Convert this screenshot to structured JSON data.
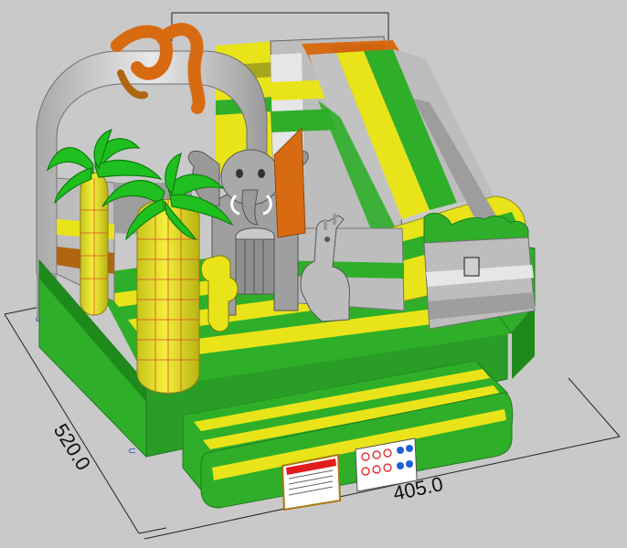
{
  "dimensions": {
    "depth_label": "520.0",
    "width_label": "405.0"
  },
  "colors": {
    "background": "#c9c9c9",
    "green": "#2fae2a",
    "green_dark": "#1f8a1c",
    "yellow": "#e9e419",
    "yellow_dark": "#b9b410",
    "olive": "#a8a51e",
    "grey": "#bdbdbd",
    "grey_dark": "#8f8f8f",
    "white_grey": "#e6e6e6",
    "orange": "#d86a12",
    "brown": "#b0650f",
    "leaf": "#1fbf1f",
    "leaf_dark": "#0d7e0d",
    "trunk": "#efe52a",
    "trunk_line": "#d8562a"
  },
  "objects": [
    "inflatable-bouncer-base",
    "front-steps",
    "grey-arch-frame",
    "orange-serpent",
    "palm-tree-left",
    "palm-tree-right",
    "elephant-head",
    "giraffe",
    "slide",
    "right-wall-box",
    "warning-label",
    "safety-pictogram-sign"
  ]
}
